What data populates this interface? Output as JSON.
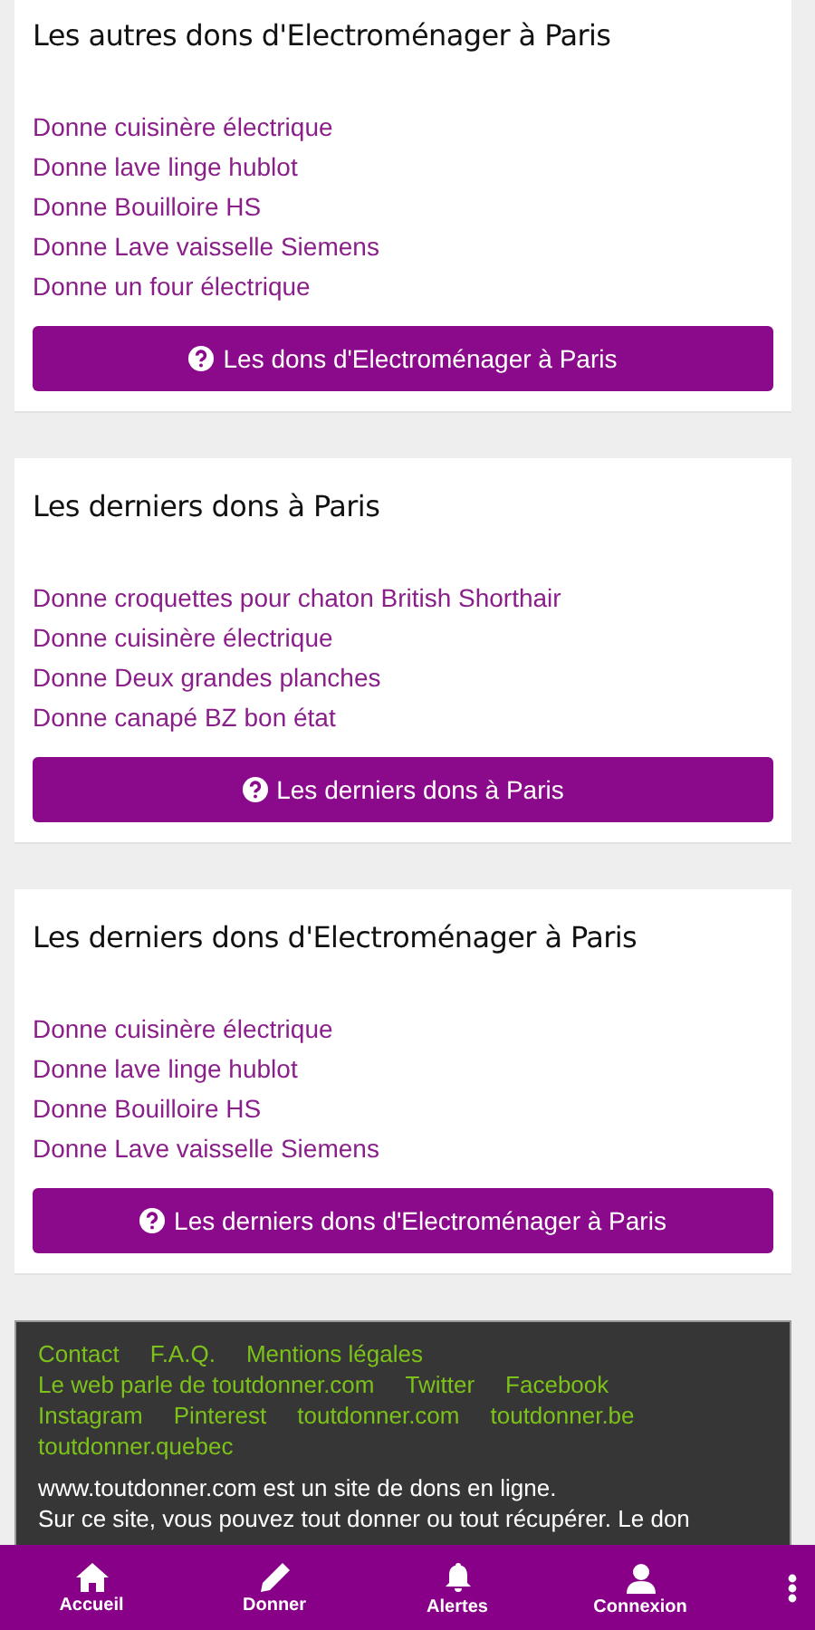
{
  "sections": [
    {
      "title": "Les autres dons d'Electroménager à Paris",
      "links": [
        "Donne cuisinère électrique",
        "Donne lave linge hublot",
        "Donne Bouilloire HS",
        "Donne Lave vaisselle Siemens",
        "Donne un four électrique"
      ],
      "button": {
        "label": "Les dons d'Electroménager à Paris"
      }
    },
    {
      "title": "Les derniers dons à Paris",
      "links": [
        "Donne croquettes pour chaton British Shorthair",
        "Donne cuisinère électrique",
        "Donne Deux grandes planches",
        "Donne canapé BZ bon état"
      ],
      "button": {
        "label": "Les derniers dons à Paris"
      }
    },
    {
      "title": "Les derniers dons d'Electroménager à Paris",
      "links": [
        "Donne cuisinère électrique",
        "Donne lave linge hublot",
        "Donne Bouilloire HS",
        "Donne Lave vaisselle Siemens"
      ],
      "button": {
        "label": "Les derniers dons d'Electroménager à Paris"
      }
    }
  ],
  "footer": {
    "link_rows": [
      [
        "Contact",
        "F.A.Q.",
        "Mentions légales"
      ],
      [
        "Le web parle de toutdonner.com",
        "Twitter",
        "Facebook"
      ],
      [
        "Instagram",
        "Pinterest",
        "toutdonner.com",
        "toutdonner.be"
      ],
      [
        "toutdonner.quebec"
      ]
    ],
    "paragraphs": [
      "www.toutdonner.com est un site de dons en ligne.",
      "Sur ce site, vous pouvez tout donner ou tout récupérer. Le don"
    ]
  },
  "bottom_nav": {
    "items": [
      {
        "label": "Accueil",
        "kind": "home"
      },
      {
        "label": "Donner",
        "kind": "pencil"
      },
      {
        "label": "Alertes",
        "kind": "bell"
      },
      {
        "label": "Connexion",
        "kind": "user"
      }
    ]
  }
}
